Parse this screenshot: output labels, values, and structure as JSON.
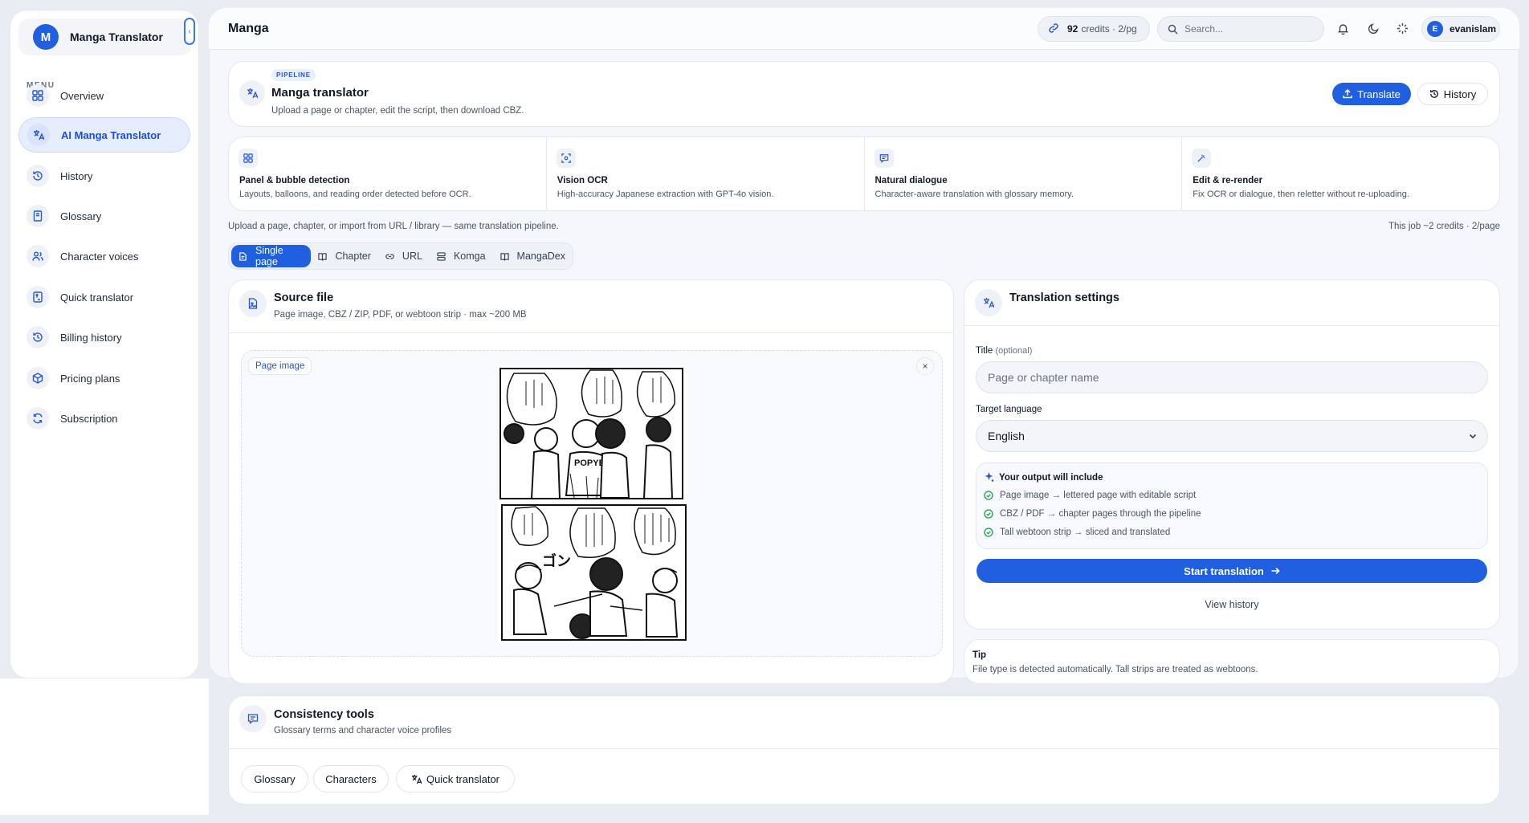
{
  "brand": {
    "initial": "M",
    "name": "Manga Translator"
  },
  "sidebar": {
    "menu_label": "MENU",
    "items": [
      {
        "label": "Overview",
        "icon": "grid-icon"
      },
      {
        "label": "AI Manga Translator",
        "icon": "translate-icon",
        "active": true
      },
      {
        "label": "History",
        "icon": "history-icon"
      },
      {
        "label": "Glossary",
        "icon": "book-icon"
      },
      {
        "label": "Character voices",
        "icon": "users-icon"
      },
      {
        "label": "Quick translator",
        "icon": "quick-translate-icon"
      },
      {
        "label": "Billing history",
        "icon": "history-icon"
      },
      {
        "label": "Pricing plans",
        "icon": "box-icon"
      },
      {
        "label": "Subscription",
        "icon": "refresh-icon"
      }
    ]
  },
  "topbar": {
    "title": "Manga",
    "credits": "92",
    "credits_unit": "credits · 2/pg",
    "search_placeholder": "Search...",
    "user_initial": "E",
    "username": "evanislam"
  },
  "header": {
    "badge": "PIPELINE",
    "title": "Manga translator",
    "subtitle": "Upload a page or chapter, edit the script, then download CBZ.",
    "translate_label": "Translate",
    "history_label": "History"
  },
  "features": [
    {
      "title": "Panel & bubble detection",
      "desc": "Layouts, balloons, and reading order detected before OCR.",
      "icon": "grid-icon"
    },
    {
      "title": "Vision OCR",
      "desc": "High-accuracy Japanese extraction with GPT-4o vision.",
      "icon": "scan-icon"
    },
    {
      "title": "Natural dialogue",
      "desc": "Character-aware translation with glossary memory.",
      "icon": "chat-icon"
    },
    {
      "title": "Edit & re-render",
      "desc": "Fix OCR or dialogue, then reletter without re-uploading.",
      "icon": "wand-icon"
    }
  ],
  "info_line": "Upload a page, chapter, or import from URL / library — same translation pipeline.",
  "job_line": "This job ~2 credits · 2/page",
  "tabs": [
    {
      "label": "Single page",
      "active": true
    },
    {
      "label": "Chapter"
    },
    {
      "label": "URL"
    },
    {
      "label": "Komga"
    },
    {
      "label": "MangaDex"
    }
  ],
  "source": {
    "title": "Source file",
    "subtitle": "Page image, CBZ / ZIP, PDF, or webtoon strip · max ~200 MB",
    "page_image_label": "Page image",
    "close_label": "×"
  },
  "settings": {
    "title": "Translation settings",
    "title_label": "Title",
    "title_optional": "(optional)",
    "title_placeholder": "Page or chapter name",
    "target_label": "Target language",
    "target_value": "English",
    "output_title": "Your output will include",
    "output_items": [
      "Page image → lettered page with editable script",
      "CBZ / PDF → chapter pages through the pipeline",
      "Tall webtoon strip → sliced and translated"
    ],
    "start_label": "Start translation",
    "view_history": "View history"
  },
  "tip": {
    "title": "Tip",
    "text": "File type is detected automatically. Tall strips are treated as webtoons."
  },
  "consistency": {
    "title": "Consistency tools",
    "subtitle": "Glossary terms and character voice profiles",
    "chips": [
      "Glossary",
      "Characters",
      "Quick translator"
    ]
  },
  "colors": {
    "accent": "#1f5fe0",
    "background": "#e9edf3",
    "card": "#ffffff"
  }
}
